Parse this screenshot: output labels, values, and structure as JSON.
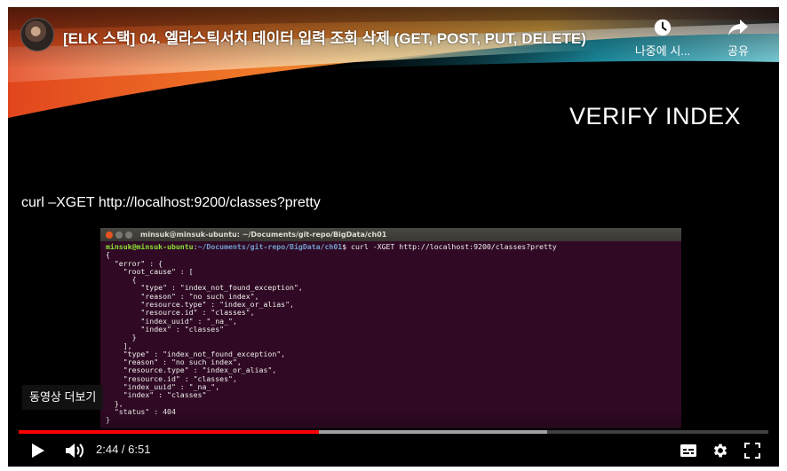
{
  "video": {
    "title": "[ELK 스택] 04. 엘라스틱서치 데이터 입력 조회 삭제 (GET, POST, PUT, DELETE)",
    "watch_later_label": "나중에 시...",
    "share_label": "공유",
    "more_videos_label": "동영상 더보기"
  },
  "slide": {
    "heading": "VERIFY INDEX",
    "command": "curl –XGET http://localhost:9200/classes?pretty"
  },
  "terminal": {
    "title": "minsuk@minsuk-ubuntu: ~/Documents/git-repo/BigData/ch01",
    "prompt_user": "minsuk@minsuk-ubuntu",
    "prompt_sep": ":",
    "prompt_path": "~/Documents/git-repo/BigData/ch01",
    "prompt_cmd": "$ curl -XGET http://localhost:9200/classes?pretty",
    "output": "{\n  \"error\" : {\n    \"root_cause\" : [\n      {\n        \"type\" : \"index_not_found_exception\",\n        \"reason\" : \"no such index\",\n        \"resource.type\" : \"index_or_alias\",\n        \"resource.id\" : \"classes\",\n        \"index_uuid\" : \"_na_\",\n        \"index\" : \"classes\"\n      }\n    ],\n    \"type\" : \"index_not_found_exception\",\n    \"reason\" : \"no such index\",\n    \"resource.type\" : \"index_or_alias\",\n    \"resource.id\" : \"classes\",\n    \"index_uuid\" : \"_na_\",\n    \"index\" : \"classes\"\n  },\n  \"status\" : 404\n}"
  },
  "controls": {
    "time_current": "2:44",
    "time_separator": " / ",
    "time_total": "6:51",
    "progress_played_pct": 40,
    "progress_buffered_pct": 70.5
  },
  "icons": {
    "play": "play-icon",
    "volume": "volume-icon",
    "subtitles": "subtitles-icon",
    "settings": "gear-icon",
    "fullscreen": "fullscreen-icon",
    "watch_later": "clock-icon",
    "share": "share-icon"
  },
  "colors": {
    "progress_played": "#ff0000",
    "terminal_bg": "#300a24",
    "prompt_user": "#8ae234",
    "prompt_path": "#729fcf"
  }
}
